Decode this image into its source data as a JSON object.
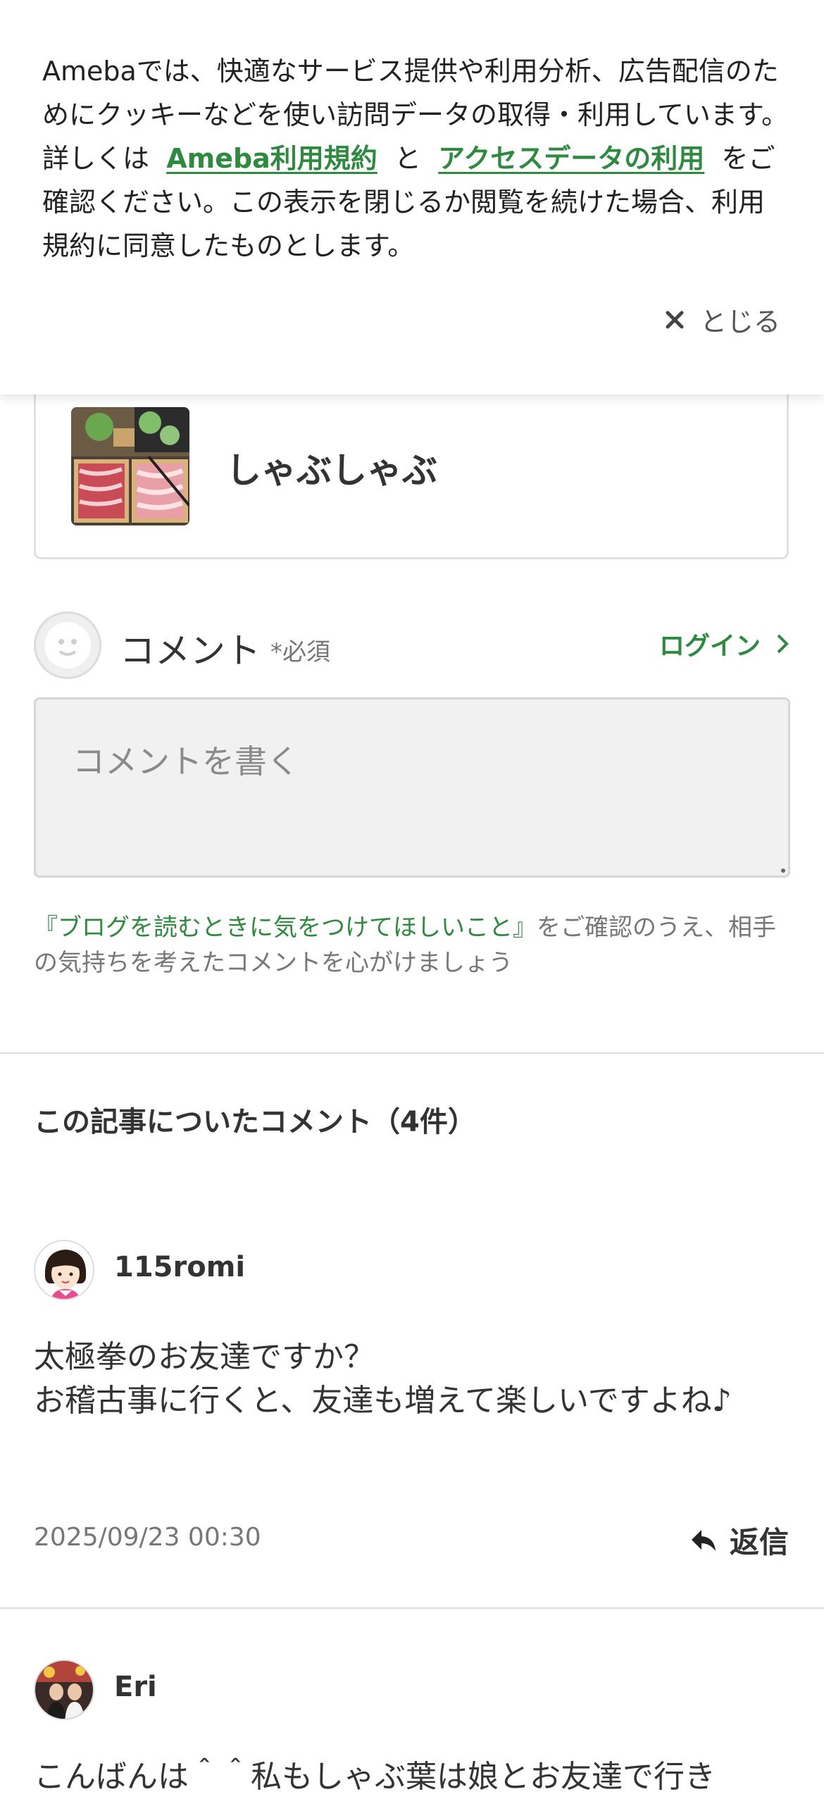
{
  "cookie_banner": {
    "text_1": "Amebaでは、快適なサービス提供や利用分析、広告配信のためにクッキーなどを使い訪問データの取得・利用しています。詳しくは",
    "link_terms": "Ameba利用規約",
    "conj": "と",
    "link_access": "アクセスデータの利用",
    "text_2": "をご確認ください。この表示を閉じるか閲覧を続けた場合、利用規約に同意したものとします。",
    "close_label": "とじる"
  },
  "recipe": {
    "title": "しゃぶしゃぶ"
  },
  "comment_form": {
    "label": "コメント",
    "required": "*必須",
    "login": "ログイン",
    "placeholder": "コメントを書く",
    "guide_link": "『ブログを読むときに気をつけてほしいこと』",
    "guide_text": "をご確認のうえ、相手の気持ちを考えたコメントを心がけましょう"
  },
  "comments_section": {
    "title": "この記事についたコメント（4件）",
    "reply_label": "返信",
    "comments": [
      {
        "user": "115romi",
        "body_line_1": "太極拳のお友達ですか？",
        "body_line_2": "お稽古事に行くと、友達も増えて楽しいですよね♪",
        "date": "2025/09/23 00:30"
      },
      {
        "user": "Eri",
        "body_line_1": "こんばんは＾＾私もしゃぶ葉は娘とお友達で行き"
      }
    ]
  },
  "icons": {
    "close": "close-icon",
    "chevron": "chevron-right-icon",
    "reply": "reply-arrow-icon"
  },
  "colors": {
    "accent_green": "#2d8a3e",
    "muted_text": "#777777"
  }
}
